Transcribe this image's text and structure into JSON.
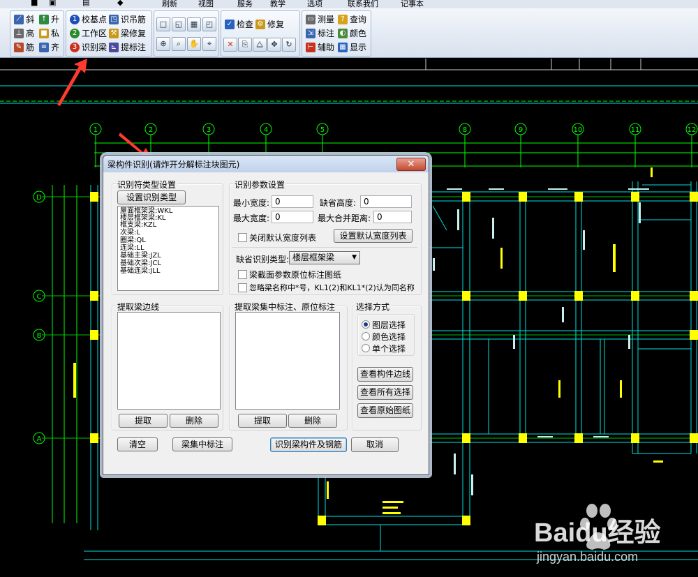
{
  "menubar": {
    "items": [
      "刷新",
      "视图",
      "服务",
      "教学",
      "选项",
      "联系我们",
      "记事本"
    ]
  },
  "ribbon": {
    "group1": [
      "斜",
      "升",
      "高",
      "私",
      "筋",
      "齐"
    ],
    "group2": {
      "step1": "校基点",
      "step1_num": "1",
      "step2": "工作区",
      "step2_num": "2",
      "step3": "识别梁",
      "step3_num": "3",
      "b1": "识吊筋",
      "b2": "梁修复",
      "b3": "提标注"
    },
    "group4": {
      "check": "检查",
      "repair": "修复"
    },
    "group5": [
      "测量",
      "查询",
      "标注",
      "颜色",
      "辅助",
      "显示"
    ]
  },
  "colors": {
    "cad_bg": "#000000",
    "axis_green": "#00ff00",
    "beam_cyan": "#00e0e0",
    "column_yellow": "#ffff00",
    "arrow_red": "#ff3b2f",
    "dialog_bg": "#f0f0f0"
  },
  "icons": {
    "close": "close-icon",
    "dropdown": "chevron-down-icon",
    "step_badge": "numbered-circle-icon"
  },
  "cad": {
    "top_axes": [
      "1",
      "2",
      "3",
      "4",
      "5",
      "8",
      "9",
      "10",
      "11",
      "12"
    ],
    "left_axes": [
      "D",
      "C",
      "B",
      "A"
    ]
  },
  "dialog": {
    "title": "梁构件识别(请炸开分解标注块图元)",
    "close_label": "✕",
    "type_group": {
      "legend": "识别符类型设置",
      "set_button": "设置识别类型",
      "types": [
        "屋面框架梁:WKL",
        "楼层框架梁:KL",
        "框支梁:KZL",
        "次梁:L",
        "圈梁:QL",
        "连梁:LL",
        "基础主梁:JZL",
        "基础次梁:JCL",
        "基础连梁:JLL"
      ]
    },
    "params_group": {
      "legend": "识别参数设置",
      "min_width_label": "最小宽度:",
      "min_width_value": "0",
      "default_height_label": "缺省高度:",
      "default_height_value": "0",
      "max_width_label": "最大宽度:",
      "max_width_value": "0",
      "max_merge_label": "最大合并距离:",
      "max_merge_value": "0",
      "close_default_width": "关闭默认宽度列表",
      "set_default_width_button": "设置默认宽度列表",
      "default_type_label": "缺省识别类型:",
      "default_type_value": "楼层框架梁",
      "section_params_check": "梁截面参数原位标注图纸",
      "ignore_star_check": "忽略梁名称中*号，KL1(2)和KL1*(2)认为同名称"
    },
    "edge_group": {
      "legend": "提取梁边线",
      "extract_button": "提取",
      "delete_button": "删除"
    },
    "annotation_group": {
      "legend": "提取梁集中标注、原位标注",
      "extract_button": "提取",
      "delete_button": "删除"
    },
    "select_group": {
      "legend": "选择方式",
      "options": [
        "图层选择",
        "颜色选择",
        "单个选择"
      ],
      "selected": "图层选择",
      "view_edges": "查看构件边线",
      "view_all": "查看所有选择",
      "view_original": "查看原始图纸"
    },
    "footer": {
      "clear": "清空",
      "focus_annotation": "梁集中标注",
      "recognize": "识别梁构件及钢筋",
      "cancel": "取消"
    }
  },
  "watermark": {
    "brand": "Baidu经验",
    "url": "jingyan.baidu.com"
  }
}
